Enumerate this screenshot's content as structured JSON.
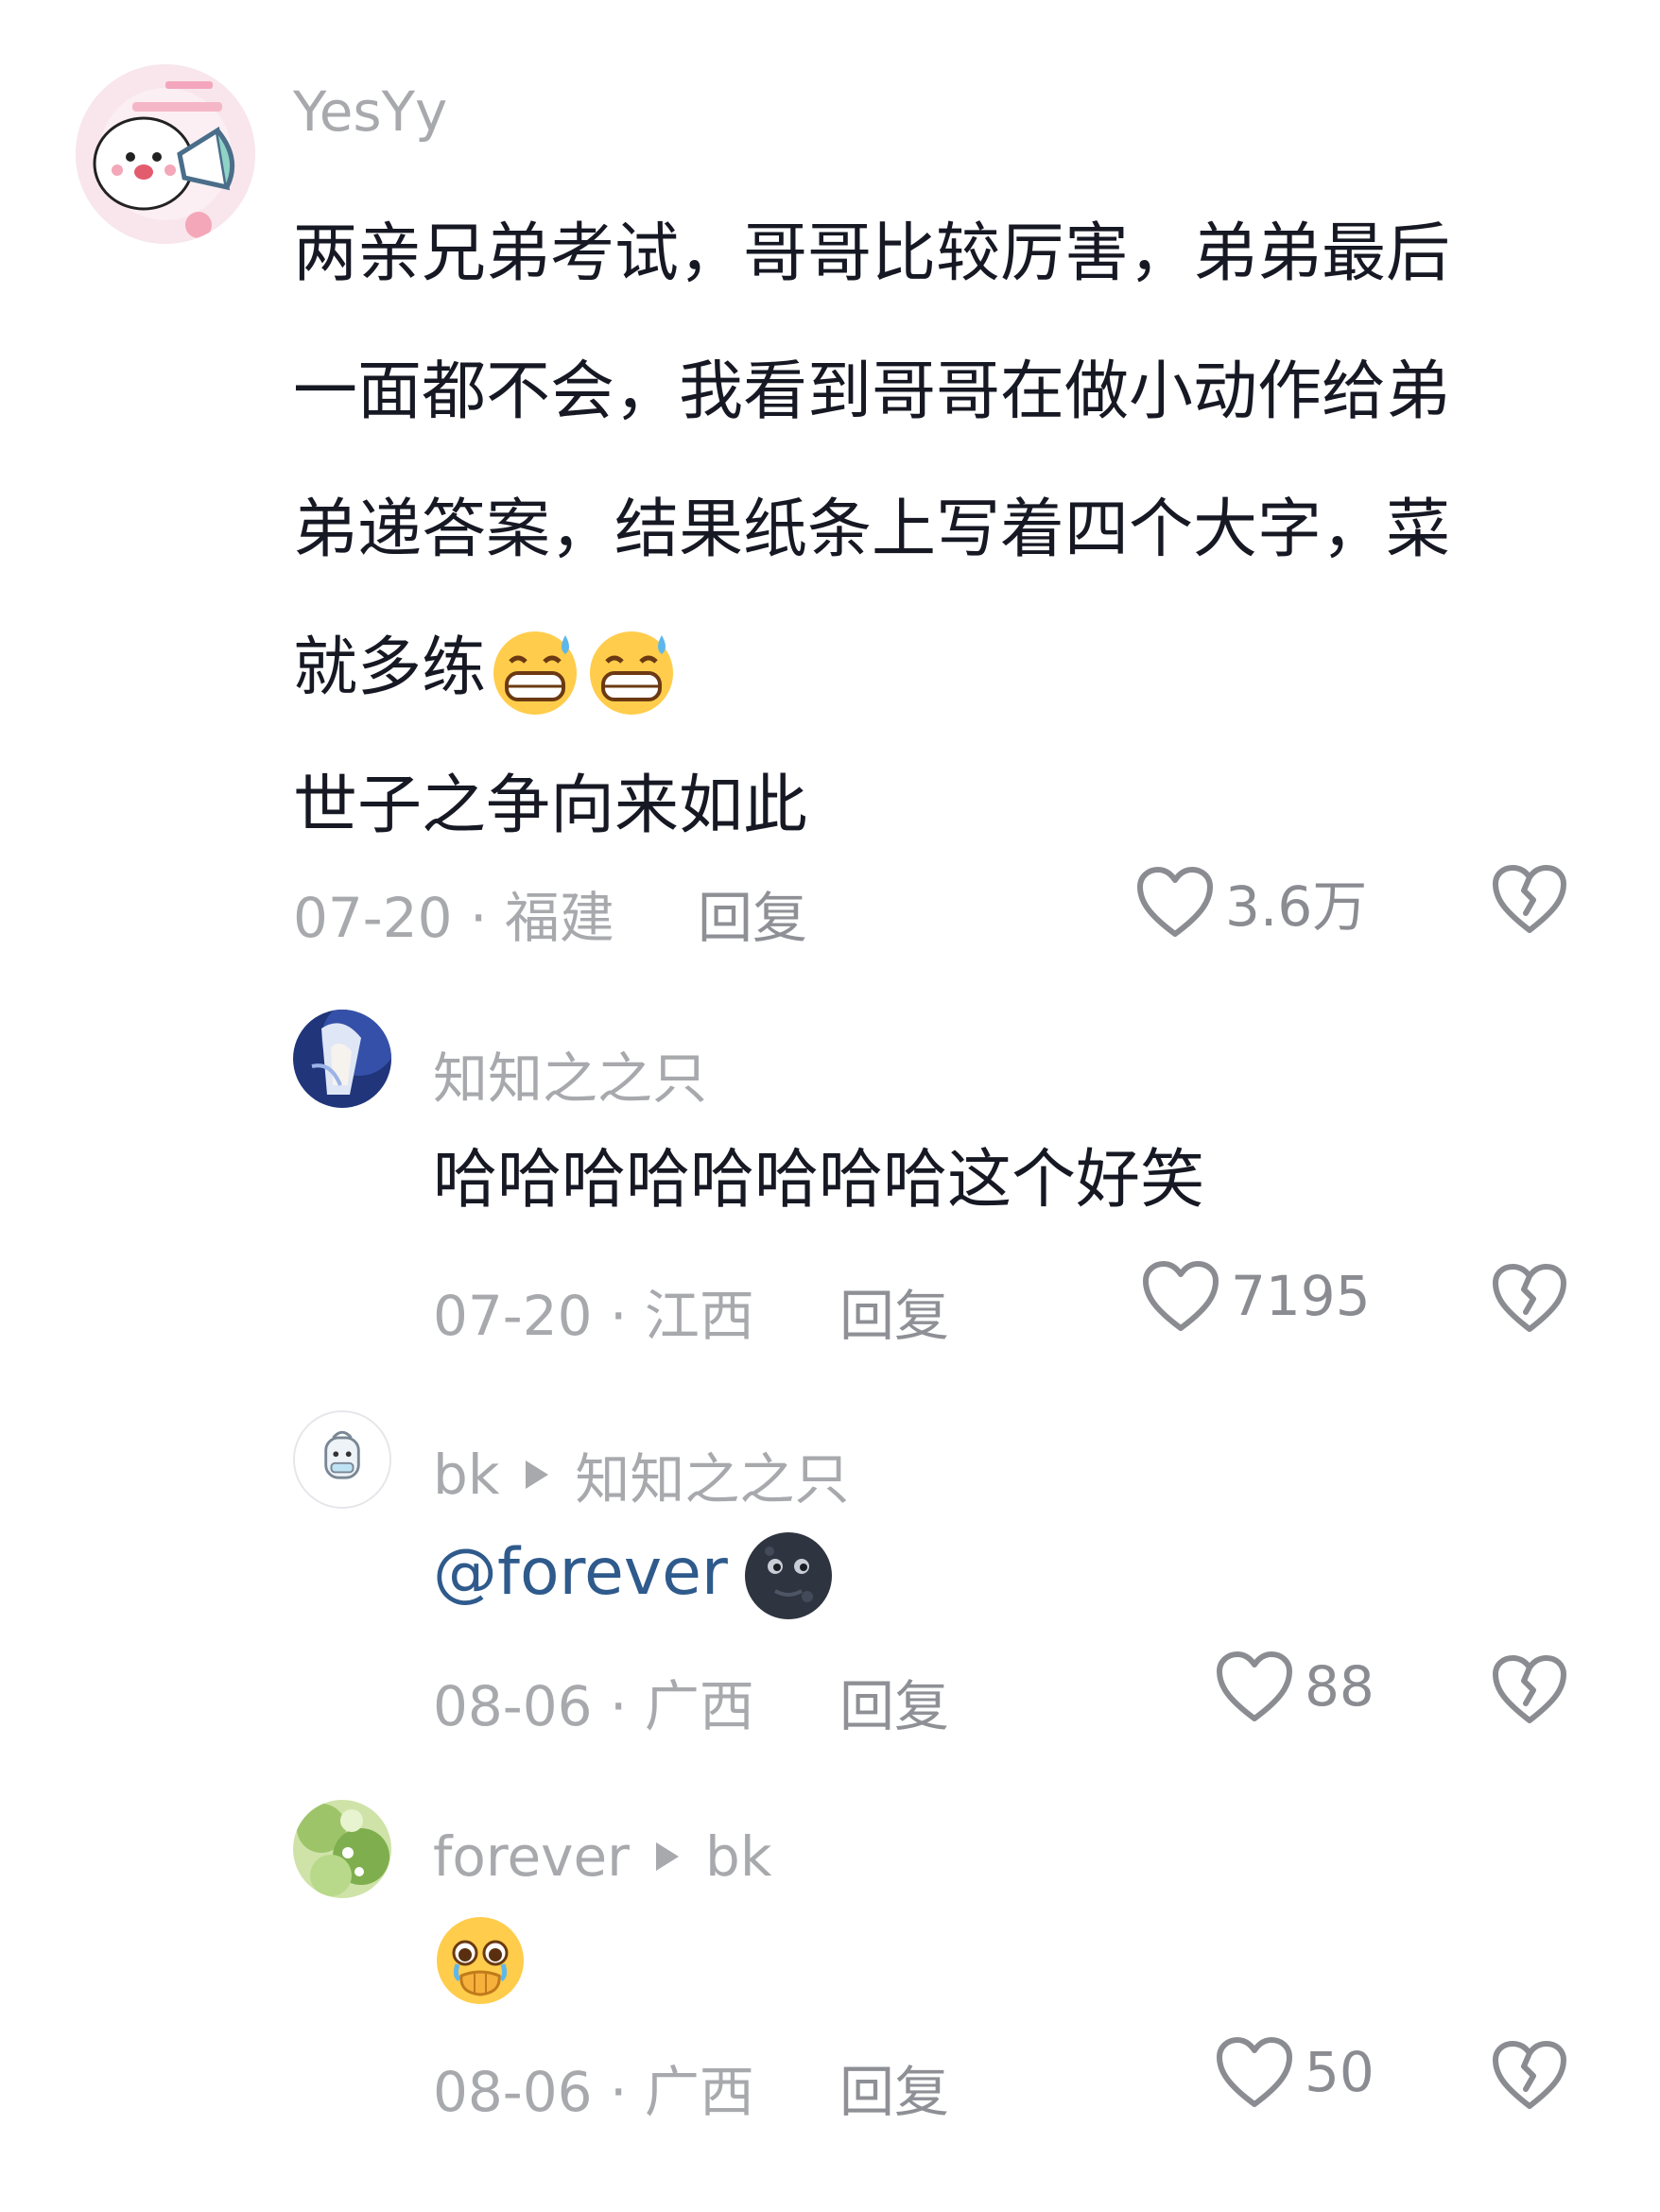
{
  "comments": [
    {
      "username": "YesYy",
      "lines": [
        "两亲兄弟考试，哥哥比较厉害，弟弟最后",
        "一面都不会，我看到哥哥在做小动作给弟",
        "弟递答案，结果纸条上写着四个大字，菜",
        "就多练"
      ],
      "extra_line": "世子之争向来如此",
      "emoji": "grinning-sweat-emoji x2",
      "meta": "07-20 · 福建",
      "reply_label": "回复",
      "likes": "3.6万"
    },
    {
      "username": "知知之之只",
      "text": "哈哈哈哈哈哈哈哈这个好笑",
      "meta": "07-20 · 江西",
      "reply_label": "回复",
      "likes": "7195"
    },
    {
      "username": "bk",
      "reply_to": "知知之之只",
      "mention": "@forever",
      "emoji": "new-moon-face-emoji",
      "meta": "08-06 · 广西",
      "reply_label": "回复",
      "likes": "88"
    },
    {
      "username": "forever",
      "reply_to": "bk",
      "emoji": "pleading-face-emoji",
      "meta": "08-06 · 广西",
      "reply_label": "回复",
      "likes": "50"
    }
  ],
  "colors": {
    "text": "#161823",
    "muted": "#a7a9ad",
    "mention": "#2f5a8c"
  }
}
